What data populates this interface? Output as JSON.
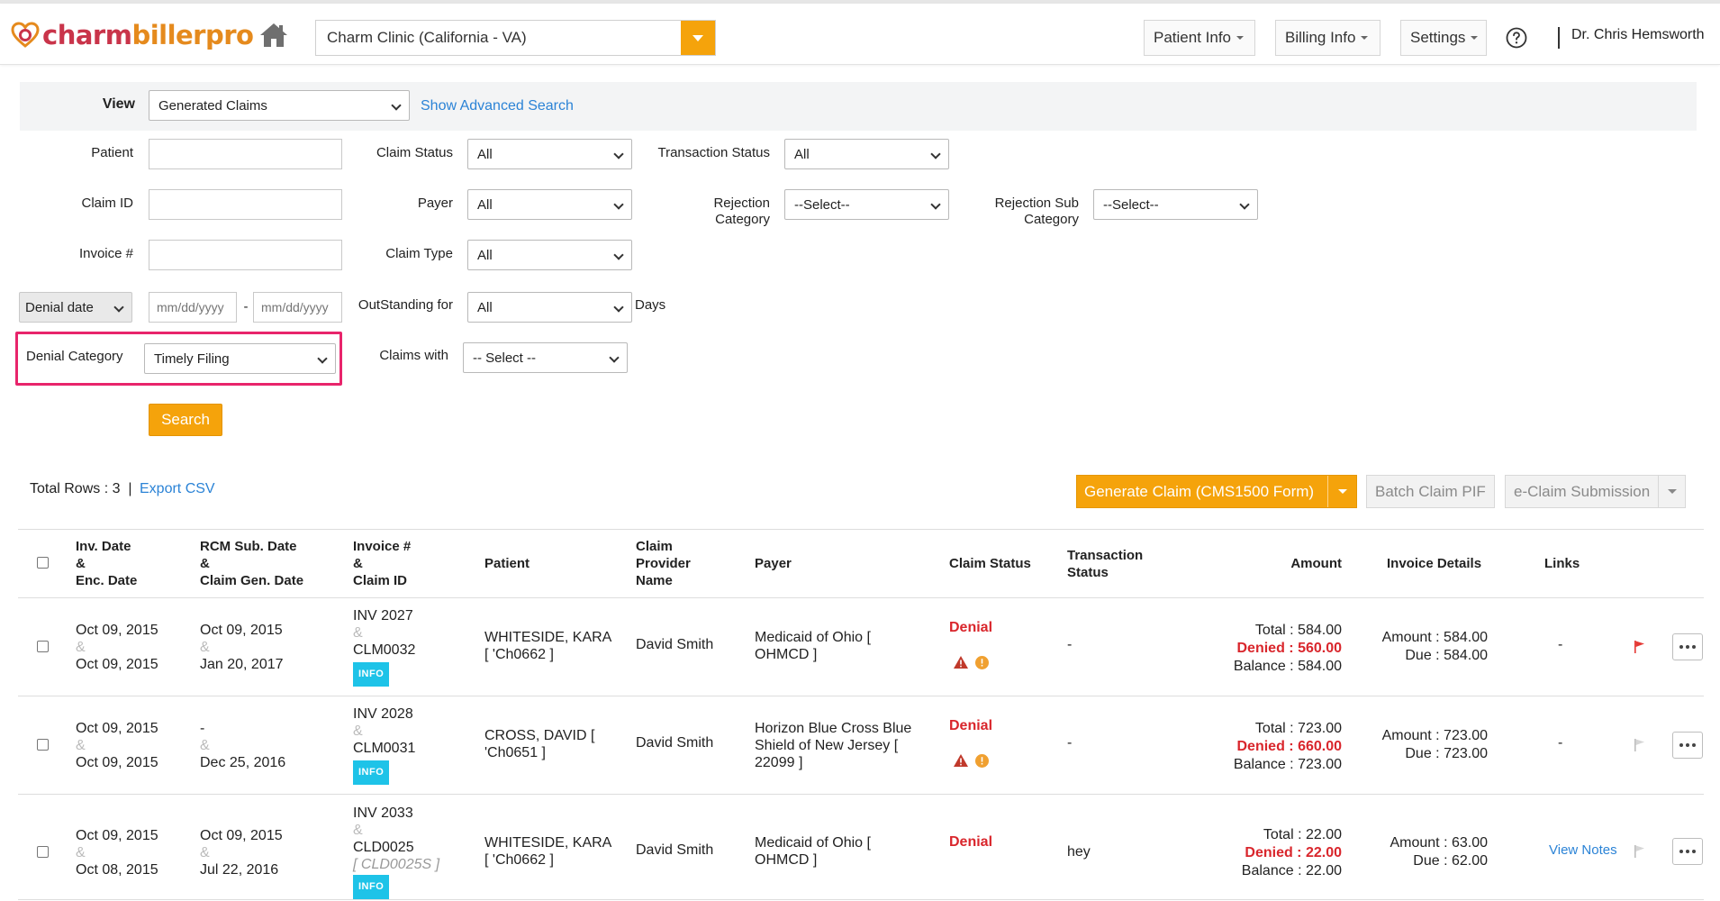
{
  "header": {
    "logo": {
      "charm": "charm",
      "biller": "billerpro"
    },
    "clinic": "Charm Clinic (California - VA)",
    "nav": [
      "Patient Info",
      "Billing Info",
      "Settings"
    ],
    "user": "Dr. Chris Hemsworth"
  },
  "filters": {
    "view_label": "View",
    "view_value": "Generated Claims",
    "advanced_search": "Show Advanced Search",
    "patient_label": "Patient",
    "claim_id_label": "Claim ID",
    "invoice_label": "Invoice #",
    "date_type": "Denial date",
    "date_from_placeholder": "mm/dd/yyyy",
    "date_sep": "-",
    "date_to_placeholder": "mm/dd/yyyy",
    "denial_category_label": "Denial Category",
    "denial_category_value": "Timely Filing",
    "claim_status_label": "Claim Status",
    "claim_status_value": "All",
    "payer_label": "Payer",
    "payer_value": "All",
    "claim_type_label": "Claim Type",
    "claim_type_value": "All",
    "outstanding_label": "OutStanding for",
    "outstanding_value": "All",
    "days_label": "Days",
    "claims_with_label": "Claims with",
    "claims_with_value": "-- Select --",
    "transaction_status_label": "Transaction Status",
    "transaction_status_value": "All",
    "rejection_category_label1": "Rejection",
    "rejection_category_label2": "Category",
    "rejection_category_value": "--Select--",
    "rejection_sub_label1": "Rejection Sub",
    "rejection_sub_label2": "Category",
    "rejection_sub_value": "--Select--",
    "search_button": "Search"
  },
  "toolbar": {
    "total_rows": "Total Rows : 3",
    "sep": "|",
    "export_csv": "Export CSV",
    "generate_claim": "Generate Claim (CMS1500 Form)",
    "batch_claim": "Batch Claim PIF",
    "eclaim": "e-Claim Submission"
  },
  "table": {
    "headers": {
      "inv_date": [
        "Inv. Date",
        "&",
        "Enc. Date"
      ],
      "rcm_date": [
        "RCM Sub. Date",
        "&",
        "Claim Gen. Date"
      ],
      "invoice": [
        "Invoice #",
        "&",
        "Claim ID"
      ],
      "patient": "Patient",
      "provider": [
        "Claim",
        "Provider",
        "Name"
      ],
      "payer": "Payer",
      "claim_status": "Claim Status",
      "transaction_status": [
        "Transaction",
        "Status"
      ],
      "amount": "Amount",
      "invoice_details": "Invoice Details",
      "links": "Links"
    },
    "amp": "&",
    "info": "INFO",
    "rows": [
      {
        "inv_date": "Oct 09, 2015",
        "enc_date": "Oct 09, 2015",
        "rcm_date": "Oct 09, 2015",
        "gen_date": "Jan 20, 2017",
        "invoice": "INV 2027",
        "claim_id": "CLM0032",
        "claim_sub": "",
        "patient1": "WHITESIDE, KARA",
        "patient2": "[ 'Ch0662 ]",
        "provider": "David Smith",
        "payer1": "Medicaid of Ohio [",
        "payer2": "OHMCD ]",
        "payer3": "",
        "status": "Denial",
        "transaction": "-",
        "total": "Total : 584.00",
        "denied": "Denied : 560.00",
        "balance": "Balance : 584.00",
        "details_amount": "Amount : 584.00",
        "details_due": "Due : 584.00",
        "links": "-"
      },
      {
        "inv_date": "Oct 09, 2015",
        "enc_date": "Oct 09, 2015",
        "rcm_date": "-",
        "gen_date": "Dec 25, 2016",
        "invoice": "INV 2028",
        "claim_id": "CLM0031",
        "claim_sub": "",
        "patient1": "CROSS, DAVID [",
        "patient2": "'Ch0651 ]",
        "provider": "David Smith",
        "payer1": "Horizon Blue Cross Blue",
        "payer2": "Shield of New Jersey [",
        "payer3": "22099 ]",
        "status": "Denial",
        "transaction": "-",
        "total": "Total : 723.00",
        "denied": "Denied : 660.00",
        "balance": "Balance : 723.00",
        "details_amount": "Amount : 723.00",
        "details_due": "Due : 723.00",
        "links": "-"
      },
      {
        "inv_date": "Oct 09, 2015",
        "enc_date": "Oct 08, 2015",
        "rcm_date": "Oct 09, 2015",
        "gen_date": "Jul 22, 2016",
        "invoice": "INV 2033",
        "claim_id": "CLD0025",
        "claim_sub": "[ CLD0025S ]",
        "patient1": "WHITESIDE, KARA",
        "patient2": "[ 'Ch0662 ]",
        "provider": "David Smith",
        "payer1": "Medicaid of Ohio [",
        "payer2": "OHMCD ]",
        "payer3": "",
        "status": "Denial",
        "transaction": "hey",
        "total": "Total : 22.00",
        "denied": "Denied : 22.00",
        "balance": "Balance : 22.00",
        "details_amount": "Amount : 63.00",
        "details_due": "Due : 62.00",
        "links": "View Notes"
      }
    ]
  },
  "colors": {
    "accent": "#f5a30b",
    "link": "#2b83d6",
    "denial": "#d9262c",
    "highlight": "#e8246b",
    "info_badge": "#1ec3e8"
  },
  "icons": [
    "home-icon",
    "question-circle-icon",
    "warning-triangle-icon",
    "alert-circle-icon",
    "flag-icon",
    "more-icon",
    "chevron-down-icon"
  ]
}
